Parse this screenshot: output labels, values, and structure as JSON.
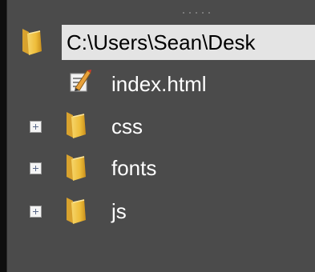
{
  "tree": {
    "root": {
      "label": "C:\\Users\\Sean\\Desk",
      "icon": "folder-icon",
      "selected": true
    },
    "items": [
      {
        "label": "index.html",
        "icon": "html-file-icon",
        "expandable": false
      },
      {
        "label": "css",
        "icon": "folder-icon",
        "expandable": true
      },
      {
        "label": "fonts",
        "icon": "folder-icon",
        "expandable": true
      },
      {
        "label": "js",
        "icon": "folder-icon",
        "expandable": true
      }
    ]
  },
  "colors": {
    "background": "#4b4b4b",
    "selection": "#e4e4e4",
    "folder": "#f2c64c",
    "text": "#ffffff"
  }
}
